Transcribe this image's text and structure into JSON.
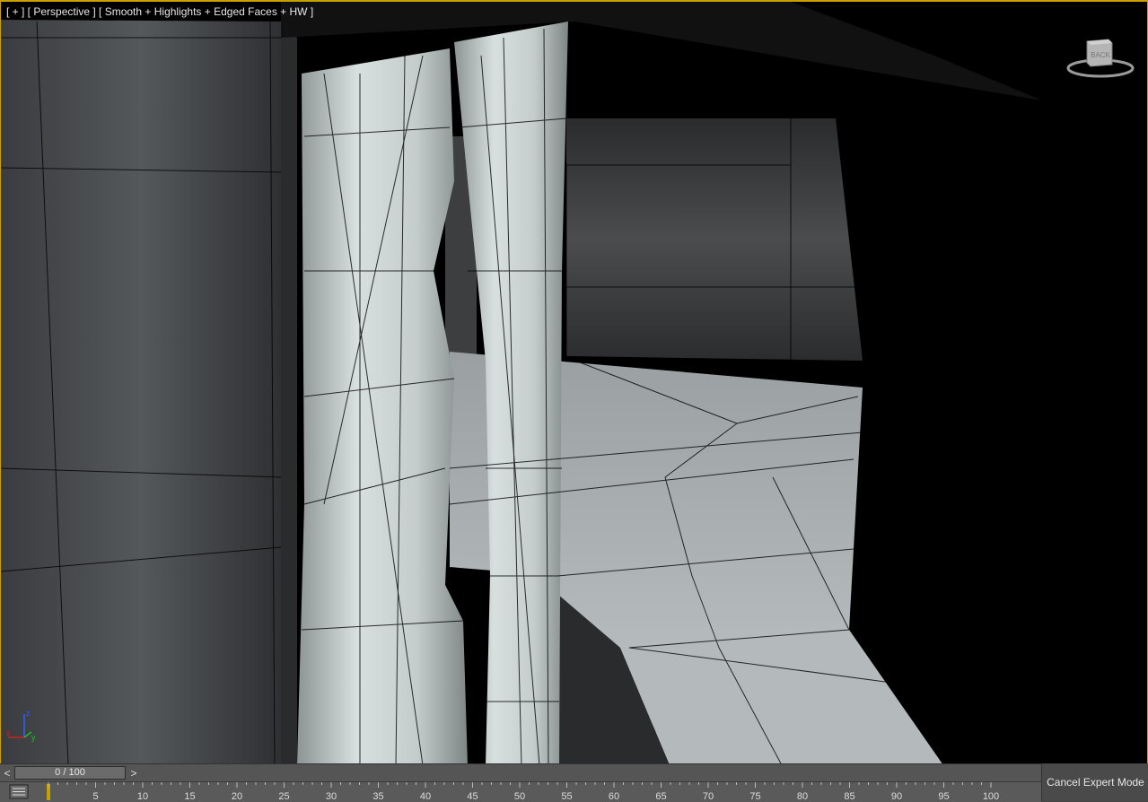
{
  "viewport": {
    "label": "[ + ] [ Perspective ] [ Smooth + Highlights + Edged Faces + HW ]",
    "viewcube_face": "BACK",
    "axes": {
      "x": "x",
      "y": "y",
      "z": "z"
    }
  },
  "timeline": {
    "prev_label": "<",
    "next_label": ">",
    "slider_text": "0 / 100",
    "frame": 0,
    "end": 100,
    "ticks": [
      "5",
      "10",
      "15",
      "20",
      "25",
      "30",
      "35",
      "40",
      "45",
      "50",
      "55",
      "60",
      "65",
      "70",
      "75",
      "80",
      "85",
      "90",
      "95",
      "100"
    ]
  },
  "status": {
    "cancel_expert_label": "Cancel Expert Mode"
  },
  "colors": {
    "viewport_border": "#c8a000",
    "axis_x": "#d02020",
    "axis_y": "#20c020",
    "axis_z": "#3060ff"
  },
  "icons": [
    "viewcube-icon",
    "axis-tripod-icon",
    "trackbar-filter-icon"
  ]
}
